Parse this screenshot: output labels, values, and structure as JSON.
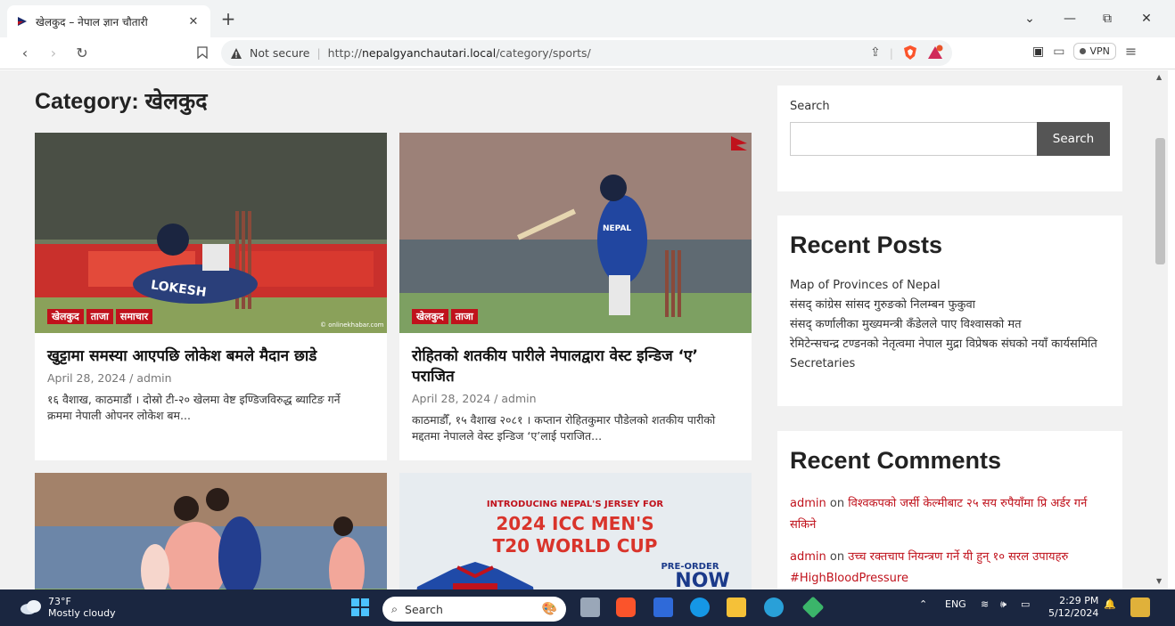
{
  "browser": {
    "tab_title": "खेलकुद – नेपाल ज्ञान चौतारी",
    "not_secure": "Not secure",
    "url_prefix": "http://",
    "url_domain": "nepalgyanchautari.local",
    "url_path": "/category/sports/",
    "vpn_label": "VPN"
  },
  "page": {
    "title": "Category: खेलकुद",
    "posts": [
      {
        "categories": [
          "खेलकुद",
          "ताजा",
          "समाचार"
        ],
        "title": "खुट्टामा समस्या आएपछि लोकेश बमले मैदान छाडे",
        "meta": "April 28, 2024 / admin",
        "excerpt": "१६ वैशाख, काठमाडौं । दोस्रो टी-२० खेलमा वेष्ट इण्डिजविरुद्ध ब्याटिङ गर्ने क्रममा नेपाली ओपनर लोकेश बम...",
        "image_caption": "LOKESH",
        "image_watermark": "© onlinekhabar.com"
      },
      {
        "categories": [
          "खेलकुद",
          "ताजा"
        ],
        "title": "रोहितको शतकीय पारीले नेपालद्वारा वेस्ट इन्डिज ‘ए’ पराजित",
        "meta": "April 28, 2024 / admin",
        "excerpt": "काठमाडौँ, १५ वैशाख २०८१ । कप्तान रोहितकुमार पौडेलको शतकीय पारीको मद्दतमा नेपालले वेस्ट इन्डिज ‘ए’लाई पराजित...",
        "image_caption": "NEPAL"
      },
      {
        "categories": [],
        "title": "",
        "meta": "",
        "excerpt": ""
      },
      {
        "categories": [],
        "title": "",
        "meta": "",
        "excerpt": "",
        "banner_line1": "INTRODUCING NEPAL'S JERSEY FOR",
        "banner_line2": "2024 ICC MEN'S",
        "banner_line3": "T20 WORLD CUP",
        "banner_pre": "PRE-ORDER",
        "banner_now": "NOW"
      }
    ]
  },
  "sidebar": {
    "search_label": "Search",
    "search_button": "Search",
    "recent_posts_title": "Recent Posts",
    "recent_posts": [
      "Map of Provinces of Nepal",
      "संसद् कांग्रेस सांसद गुरुङको निलम्बन फुकुवा",
      "संसद् कर्णालीका मुख्यमन्त्री कँडेलले पाए विश्वासको मत",
      "रेमिटेन्सचन्द्र टण्डनको नेतृत्वमा नेपाल मुद्रा विप्रेषक संघको नयाँ कार्यसमिति",
      "Secretaries"
    ],
    "recent_comments_title": "Recent Comments",
    "recent_comments": [
      {
        "author": "admin",
        "on": "on",
        "post": "विश्वकपको जर्सी केल्मीबाट २५ सय रुपैयाँमा प्रि अर्डर गर्न सकिने"
      },
      {
        "author": "admin",
        "on": "on",
        "post": "उच्च रक्तचाप नियन्त्रण गर्ने यी हुन् १० सरल उपायहरु #HighBloodPressure"
      }
    ]
  },
  "taskbar": {
    "temp": "73°F",
    "weather": "Mostly cloudy",
    "search_placeholder": "Search",
    "lang": "ENG",
    "time": "2:29 PM",
    "date": "5/12/2024"
  }
}
